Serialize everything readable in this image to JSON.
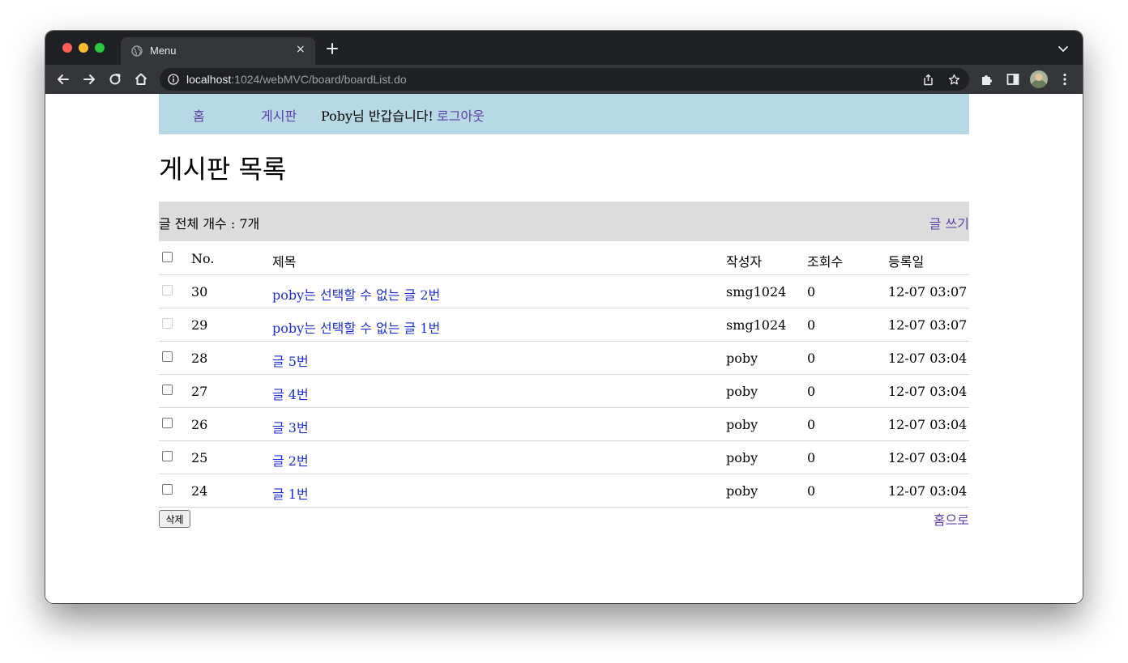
{
  "browser": {
    "tab_title": "Menu",
    "tab_close": "×",
    "url_host": "localhost",
    "url_path": ":1024/webMVC/board/boardList.do"
  },
  "nav": {
    "home": "홈",
    "board": "게시판",
    "greeting": "Poby님 반갑습니다!",
    "logout": "로그아웃"
  },
  "page": {
    "title": "게시판 목록",
    "summary": "글 전체 개수 : 7개",
    "write": "글 쓰기",
    "delete_button": "삭제",
    "home_link": "홈으로"
  },
  "table": {
    "headers": {
      "no": "No.",
      "title": "제목",
      "author": "작성자",
      "views": "조회수",
      "date": "등록일"
    },
    "rows": [
      {
        "no": "30",
        "title": "poby는 선택할 수 없는 글 2번",
        "author": "smg1024",
        "views": "0",
        "date": "12-07 03:07",
        "selectable": false
      },
      {
        "no": "29",
        "title": "poby는 선택할 수 없는 글 1번",
        "author": "smg1024",
        "views": "0",
        "date": "12-07 03:07",
        "selectable": false
      },
      {
        "no": "28",
        "title": "글 5번",
        "author": "poby",
        "views": "0",
        "date": "12-07 03:04",
        "selectable": true
      },
      {
        "no": "27",
        "title": "글 4번",
        "author": "poby",
        "views": "0",
        "date": "12-07 03:04",
        "selectable": true
      },
      {
        "no": "26",
        "title": "글 3번",
        "author": "poby",
        "views": "0",
        "date": "12-07 03:04",
        "selectable": true
      },
      {
        "no": "25",
        "title": "글 2번",
        "author": "poby",
        "views": "0",
        "date": "12-07 03:04",
        "selectable": true
      },
      {
        "no": "24",
        "title": "글 1번",
        "author": "poby",
        "views": "0",
        "date": "12-07 03:04",
        "selectable": true
      }
    ]
  },
  "colors": {
    "nav_bg": "#b7d9e5",
    "summary_bg": "#dcdcdc",
    "visited_link": "#5b3fa8",
    "title_link": "#1c2fd6",
    "chrome_dark": "#202124"
  }
}
